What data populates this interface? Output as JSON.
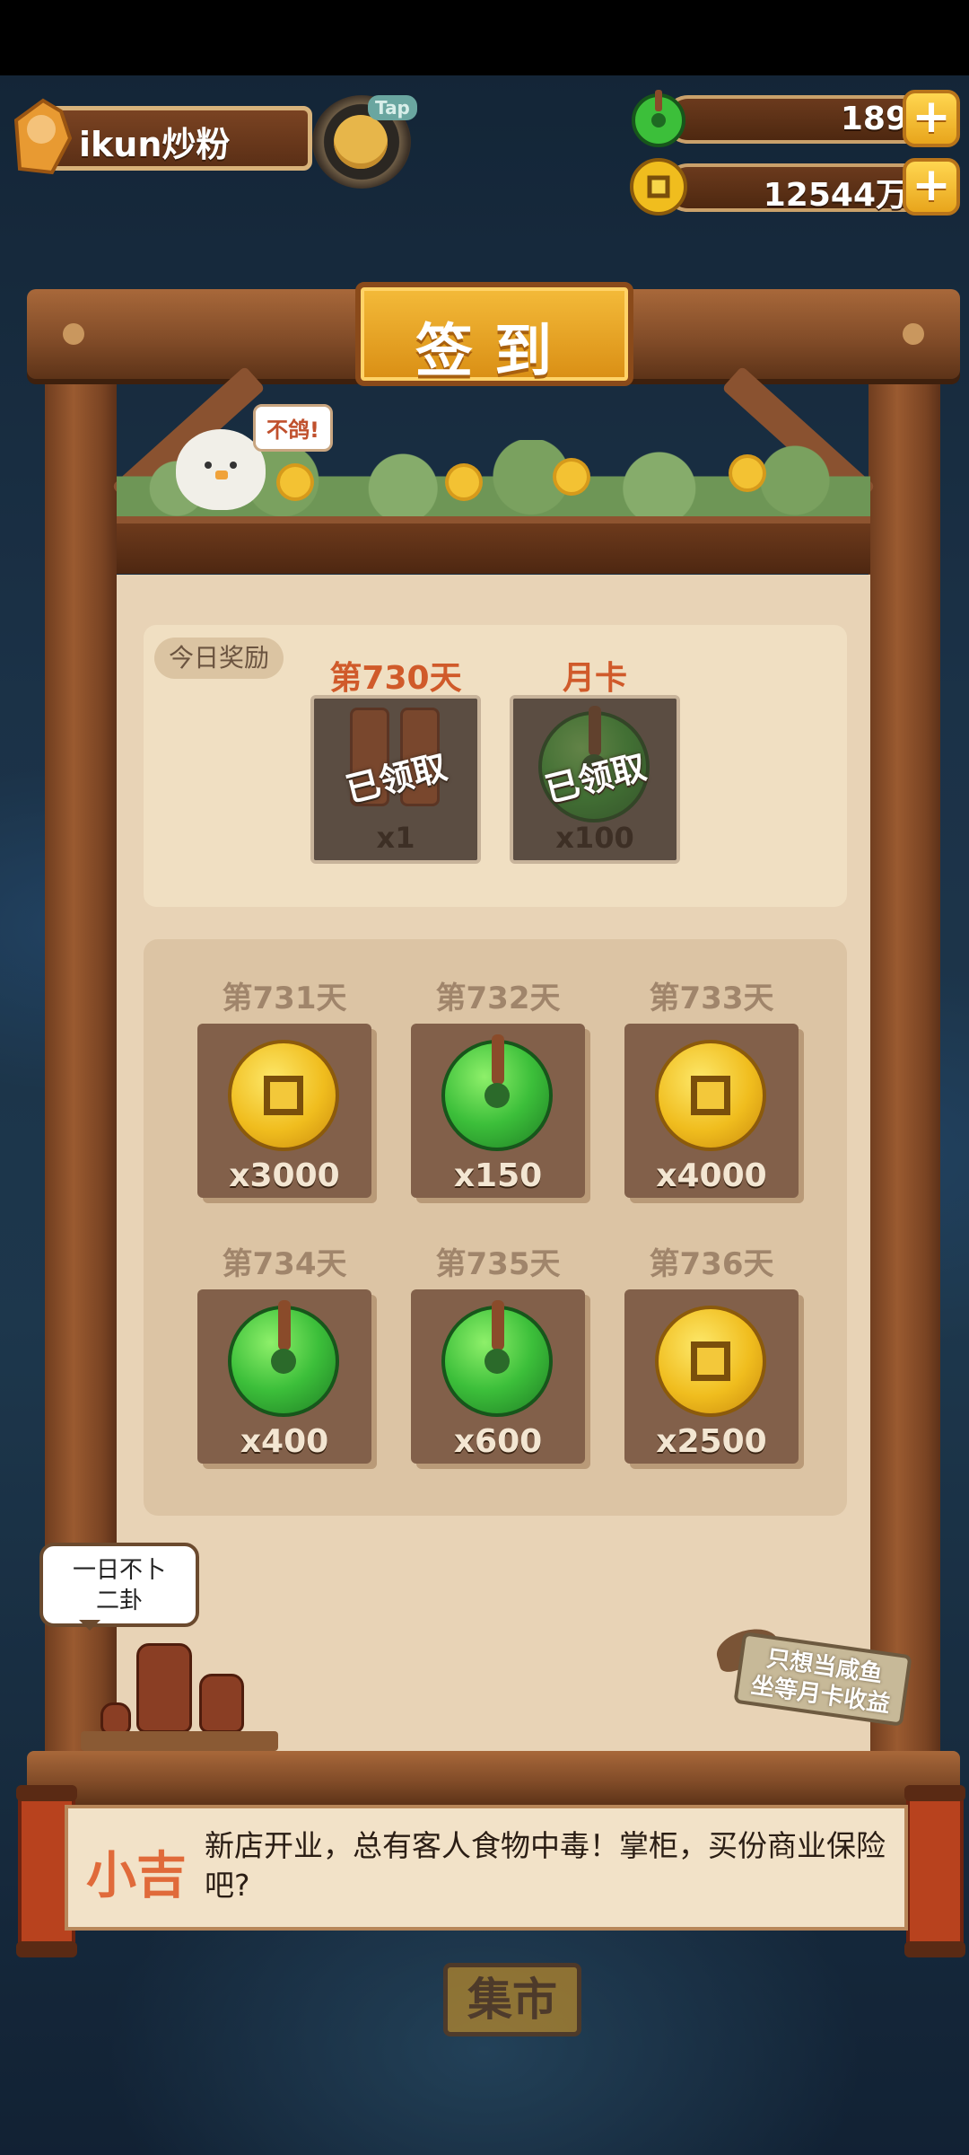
{
  "player": {
    "name": "ikun炒粉",
    "tap_label": "Tap"
  },
  "resources": {
    "jade": {
      "value": "189",
      "icon": "jade-coin-icon"
    },
    "coins": {
      "value": "12544万",
      "icon": "gold-coin-icon"
    },
    "plus_label": "+"
  },
  "signin": {
    "title": "签到",
    "mascot_bubble": "不鸽!",
    "today": {
      "tag": "今日奖励",
      "items": [
        {
          "label": "第730天",
          "status": "已领取",
          "qty": "x1",
          "icon": "firecracker-icon"
        },
        {
          "label": "月卡",
          "status": "已领取",
          "qty": "x100",
          "icon": "jade-coin-icon"
        }
      ]
    },
    "days": [
      {
        "label": "第731天",
        "qty": "x3000",
        "icon": "gold-coin-icon"
      },
      {
        "label": "第732天",
        "qty": "x150",
        "icon": "jade-coin-icon"
      },
      {
        "label": "第733天",
        "qty": "x4000",
        "icon": "gold-coin-icon"
      },
      {
        "label": "第734天",
        "qty": "x400",
        "icon": "jade-coin-icon"
      },
      {
        "label": "第735天",
        "qty": "x600",
        "icon": "jade-coin-icon"
      },
      {
        "label": "第736天",
        "qty": "x2500",
        "icon": "gold-coin-icon"
      }
    ]
  },
  "fortune_bubble": "一日不卜\n二卦",
  "sign_text": "只想当咸鱼\n坐等月卡收益",
  "dialog": {
    "speaker": "小吉",
    "text": "新店开业，总有客人食物中毒！掌柜，买份商业保险吧?"
  },
  "market_label": "集市",
  "colors": {
    "gold": "#f0bd1e",
    "jade": "#3cbf3a",
    "accent": "#d05a2a"
  }
}
